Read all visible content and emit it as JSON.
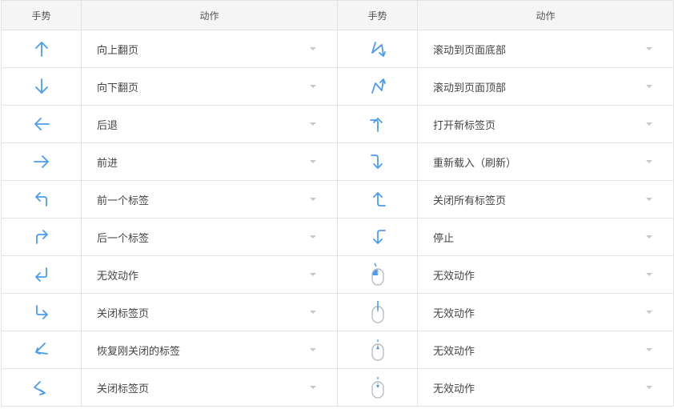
{
  "header": {
    "gesture": "手势",
    "action": "动作"
  },
  "colors": {
    "accent": "#4a9cf0",
    "mouse": "#b8bdc4",
    "border": "#e3e3e3"
  },
  "left_rows": [
    {
      "icon": "arrow-up-icon",
      "action": "向上翻页"
    },
    {
      "icon": "arrow-down-icon",
      "action": "向下翻页"
    },
    {
      "icon": "arrow-left-icon",
      "action": "后退"
    },
    {
      "icon": "arrow-right-icon",
      "action": "前进"
    },
    {
      "icon": "turn-up-left-icon",
      "action": "前一个标签"
    },
    {
      "icon": "turn-up-right-icon",
      "action": "后一个标签"
    },
    {
      "icon": "return-left-icon",
      "action": "无效动作"
    },
    {
      "icon": "down-right-icon",
      "action": "关闭标签页"
    },
    {
      "icon": "zigzag-left-icon",
      "action": "恢复刚关闭的标签"
    },
    {
      "icon": "zigzag-right-icon",
      "action": "关闭标签页"
    }
  ],
  "right_rows": [
    {
      "icon": "zigzag-down-icon",
      "action": "滚动到页面底部"
    },
    {
      "icon": "zigzag-up-icon",
      "action": "滚动到页面顶部"
    },
    {
      "icon": "right-up-icon",
      "action": "打开新标签页"
    },
    {
      "icon": "right-down-icon",
      "action": "重新载入（刷新）"
    },
    {
      "icon": "left-up-icon",
      "action": "关闭所有标签页"
    },
    {
      "icon": "left-down-icon",
      "action": "停止"
    },
    {
      "icon": "mouse-left-click-icon",
      "action": "无效动作"
    },
    {
      "icon": "mouse-middle-click-icon",
      "action": "无效动作"
    },
    {
      "icon": "mouse-scroll-up-icon",
      "action": "无效动作"
    },
    {
      "icon": "mouse-scroll-down-icon",
      "action": "无效动作"
    }
  ]
}
